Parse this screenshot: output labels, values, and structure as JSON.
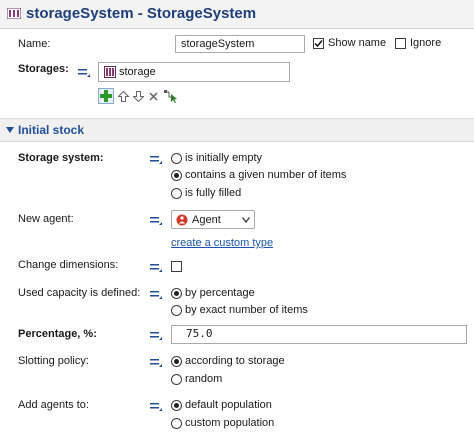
{
  "title": "storageSystem - StorageSystem",
  "name_field": {
    "label": "Name:",
    "value": "storageSystem"
  },
  "show_name": {
    "label": "Show name",
    "checked": true
  },
  "ignore": {
    "label": "Ignore",
    "checked": false
  },
  "storages": {
    "label": "Storages:",
    "items": [
      "storage"
    ]
  },
  "section": {
    "label": "Initial stock"
  },
  "storage_system": {
    "label": "Storage system:",
    "options": [
      "is initially empty",
      "contains a given number of items",
      "is fully filled"
    ],
    "selected": 1
  },
  "new_agent": {
    "label": "New agent:",
    "value": "Agent",
    "link": "create a custom type"
  },
  "change_dimensions": {
    "label": "Change dimensions:",
    "checked": false
  },
  "used_capacity": {
    "label": "Used capacity is defined:",
    "options": [
      "by percentage",
      "by exact number of items"
    ],
    "selected": 0
  },
  "percentage": {
    "label": "Percentage, %:",
    "value": "75.0"
  },
  "slotting_policy": {
    "label": "Slotting policy:",
    "options": [
      "according to storage",
      "random"
    ],
    "selected": 0
  },
  "add_agents_to": {
    "label": "Add agents to:",
    "options": [
      "default population",
      "custom population"
    ],
    "selected": 0
  },
  "icons": [
    "storage-system-icon",
    "equals-icon",
    "add-icon",
    "move-up-icon",
    "move-down-icon",
    "remove-icon",
    "select-in-graph-icon",
    "collapse-triangle-icon",
    "agent-icon",
    "dropdown-arrow-icon",
    "check-icon"
  ],
  "colors": {
    "title": "#1f3f7a",
    "section": "#1f4f9a",
    "link": "#1a56b0"
  }
}
